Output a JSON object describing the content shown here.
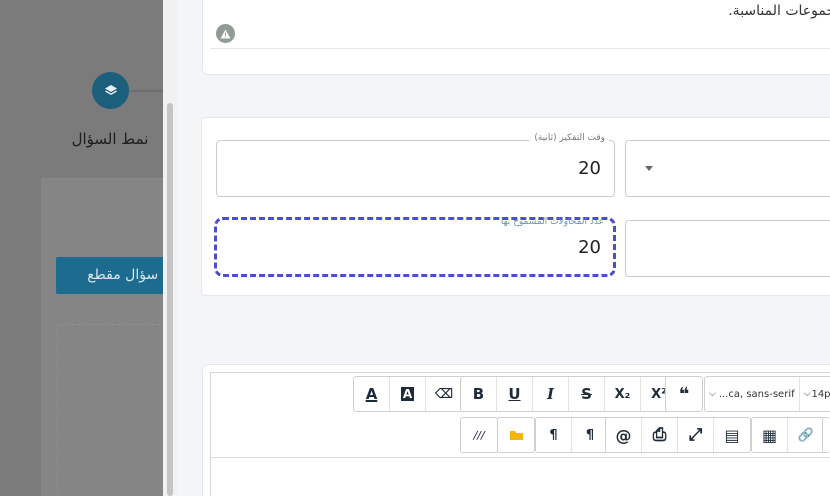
{
  "background": {
    "step_label": "نمط السؤال",
    "cut_button_label": "ة سؤال مقطع"
  },
  "top_card": {
    "text": "مجموعات المناسبة."
  },
  "fields": {
    "think_time_label": "وقت التفكير (ثانية)",
    "think_time_value": "20",
    "allowed_attempts_label": "عدد المحاولات المسموح بها",
    "allowed_attempts_value": "20"
  },
  "toolbar": {
    "row1": [
      {
        "name": "font-color-button",
        "label": "A"
      },
      {
        "name": "highlight-color-button",
        "label": "A"
      },
      {
        "name": "eraser-button",
        "label": "⌫"
      },
      {
        "name": "bold-button",
        "label": "B"
      },
      {
        "name": "underline-button",
        "label": "U"
      },
      {
        "name": "italic-button",
        "label": "I"
      },
      {
        "name": "strikethrough-button",
        "label": "S"
      },
      {
        "name": "subscript-button",
        "label": "X₂"
      },
      {
        "name": "superscript-button",
        "label": "X²"
      },
      {
        "name": "blockquote-button",
        "label": "❝"
      }
    ],
    "font_family": "...ca, sans-serif",
    "font_size": "14p",
    "row2": [
      {
        "name": "source-code-button",
        "label": "///"
      },
      {
        "name": "file-manager-button",
        "label": "📁"
      },
      {
        "name": "ltr-direction-button",
        "label": "¶"
      },
      {
        "name": "rtl-direction-button",
        "label": "¶"
      },
      {
        "name": "mention-button",
        "label": "@"
      },
      {
        "name": "print-button",
        "label": "⎙"
      },
      {
        "name": "fullscreen-button",
        "label": "⤢"
      },
      {
        "name": "template-button",
        "label": "▤"
      },
      {
        "name": "table-button",
        "label": "▦"
      },
      {
        "name": "link-button",
        "label": "🔗"
      }
    ]
  },
  "colors": {
    "accent": "#1b5f7d",
    "focus": "#4a4fcc"
  }
}
